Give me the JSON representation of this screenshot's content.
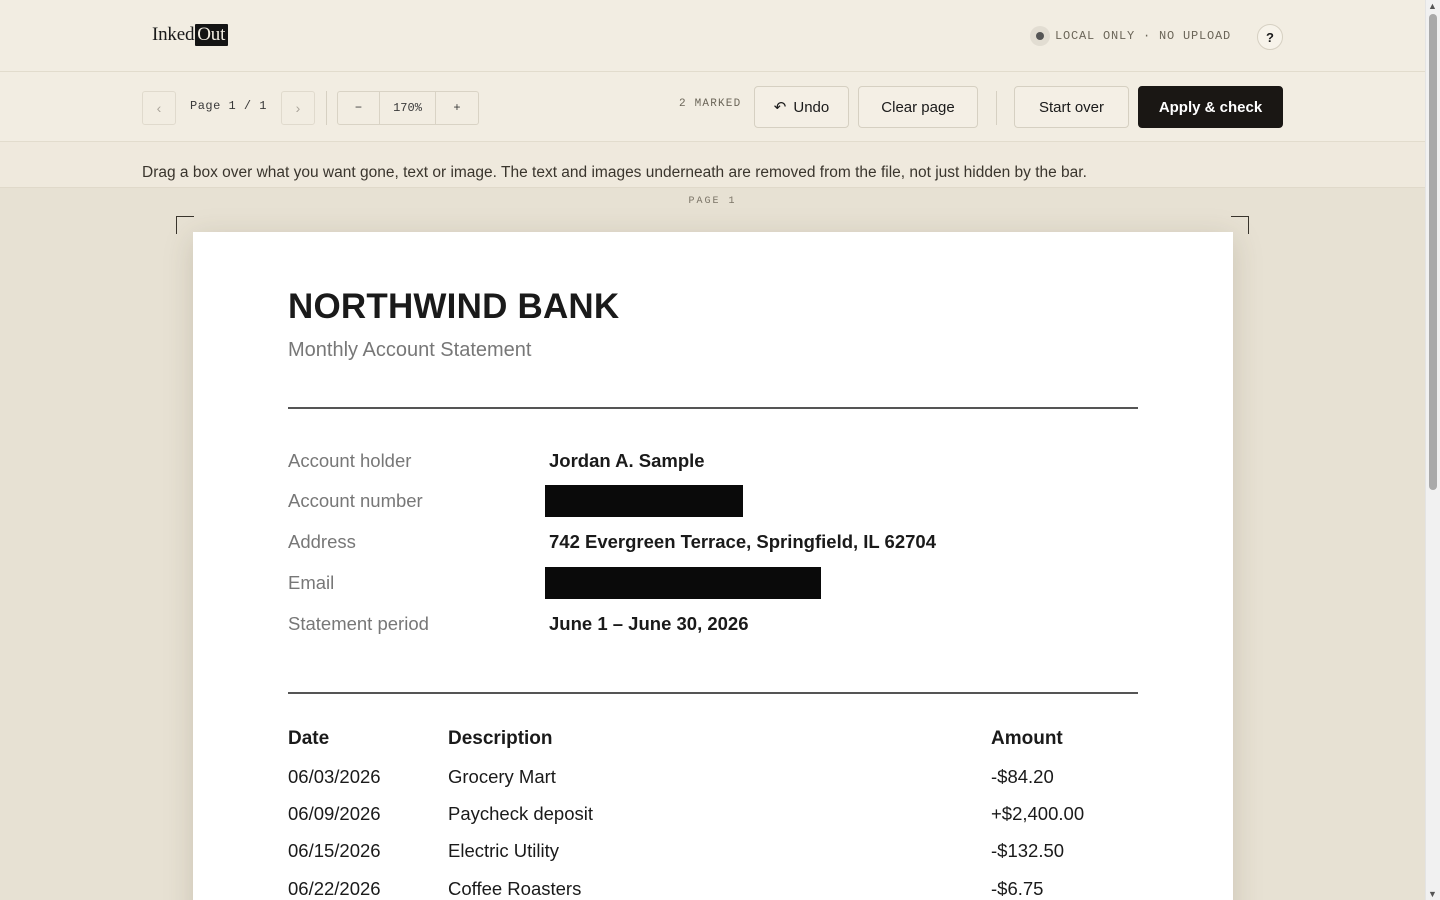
{
  "header": {
    "logo_left": "Inked",
    "logo_right": "Out",
    "local_badge": "LOCAL ONLY · NO UPLOAD",
    "help_label": "?"
  },
  "toolbar": {
    "prev_glyph": "‹",
    "next_glyph": "›",
    "page_label": "Page 1 / 1",
    "zoom_out": "−",
    "zoom_value": "170%",
    "zoom_in": "+",
    "marked_label": "2 MARKED",
    "undo_label": "Undo",
    "clear_label": "Clear page",
    "start_over_label": "Start over",
    "apply_label": "Apply & check"
  },
  "hint": "Drag a box over what you want gone, text or image. The text and images underneath are removed from the file, not just hidden by the bar.",
  "page_caption": "PAGE 1",
  "document": {
    "title": "NORTHWIND BANK",
    "subtitle": "Monthly Account Statement",
    "info": [
      {
        "label": "Account holder",
        "value": "Jordan A. Sample",
        "redacted": false
      },
      {
        "label": "Account number",
        "value": "",
        "redacted": true
      },
      {
        "label": "Address",
        "value": "742 Evergreen Terrace, Springfield, IL 62704",
        "redacted": false
      },
      {
        "label": "Email",
        "value": "",
        "redacted": true
      },
      {
        "label": "Statement period",
        "value": "June 1 – June 30, 2026",
        "redacted": false
      }
    ],
    "table": {
      "headers": [
        "Date",
        "Description",
        "Amount"
      ],
      "rows": [
        [
          "06/03/2026",
          "Grocery Mart",
          "-$84.20"
        ],
        [
          "06/09/2026",
          "Paycheck deposit",
          "+$2,400.00"
        ],
        [
          "06/15/2026",
          "Electric Utility",
          "-$132.50"
        ],
        [
          "06/22/2026",
          "Coffee Roasters",
          "-$6.75"
        ]
      ]
    }
  },
  "colors": {
    "background": "#e7e1d3",
    "bar": "#f2ede2",
    "primary_button": "#1a1714",
    "redaction": "#0a0a0a"
  }
}
